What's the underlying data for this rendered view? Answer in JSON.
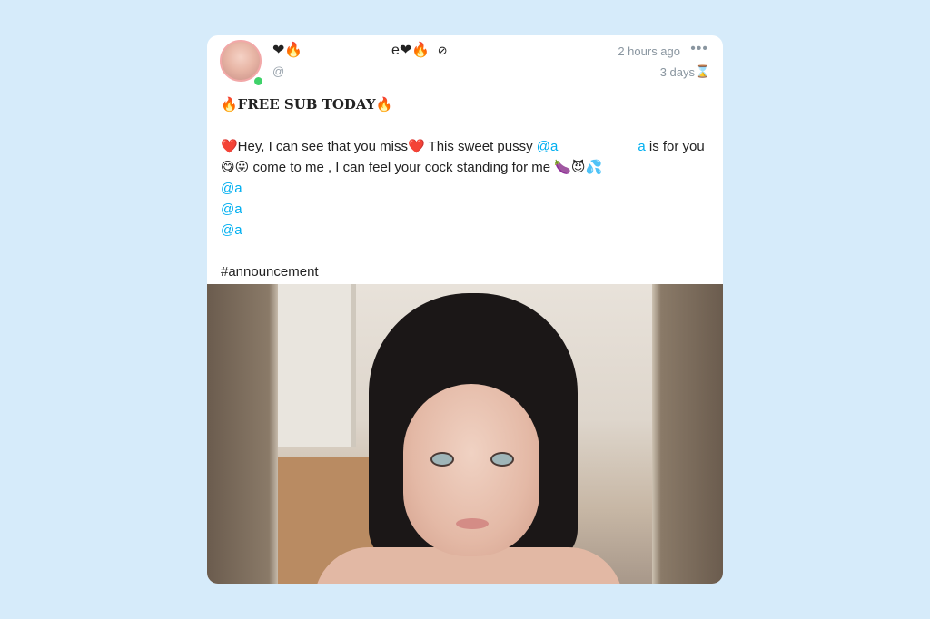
{
  "post": {
    "author": {
      "name_left": "❤🔥",
      "name_right": "e❤🔥",
      "handle": "@",
      "verified_icon": "verified-badge-icon",
      "online": true
    },
    "time_ago": "2 hours ago",
    "expiry": "3 days",
    "body": {
      "headline": "🔥FREE SUB TODAY🔥",
      "line1_prefix": "❤️Hey, I can see that you miss❤️ This sweet pussy ",
      "line1_mention": "@a",
      "line1_mention_tail": "a",
      "line1_suffix": " is for you",
      "line2": "😋😛 come to me , I can feel your cock standing for me 🍆😈💦",
      "mentions": [
        "@a",
        "@a",
        "@a"
      ],
      "hashtag": "#announcement"
    }
  },
  "colors": {
    "background": "#d6ebfa",
    "card": "#ffffff",
    "mention": "#00aff0",
    "muted": "#8a96a0",
    "online": "#3fd26a"
  }
}
